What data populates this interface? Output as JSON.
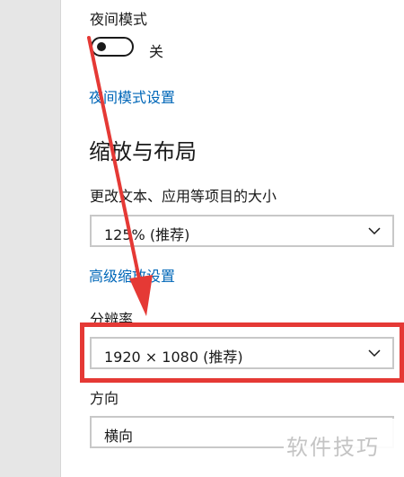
{
  "night_mode": {
    "label": "夜间模式",
    "toggle_state": "关",
    "settings_link": "夜间模式设置"
  },
  "scale_layout": {
    "title": "缩放与布局",
    "text_size_label": "更改文本、应用等项目的大小",
    "text_size_value": "125% (推荐)",
    "advanced_link": "高级缩放设置"
  },
  "resolution": {
    "label": "分辨率",
    "value": "1920 × 1080 (推荐)"
  },
  "orientation": {
    "label": "方向",
    "value": "横向"
  },
  "watermark": {
    "text": "软件技巧"
  },
  "colors": {
    "link": "#0067b8",
    "annotation": "#e53935"
  },
  "icons": {
    "dropdown": "chevron-down-icon",
    "annotation_arrow": "arrow-icon"
  }
}
